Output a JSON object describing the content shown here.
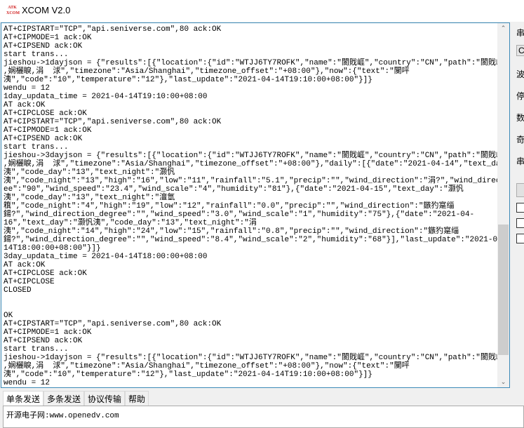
{
  "window": {
    "title": "XCOM V2.0",
    "logo_text": "ATK XCOM"
  },
  "receive_lines": [
    "AT+CIPSTART=\"TCP\",\"api.seniverse.com\",80 ack:OK",
    "AT+CIPMODE=1 ack:OK",
    "AT+CIPSEND ack:OK",
    "start trans...",
    "jieshou->1dayjson = {\"results\":[{\"location\":{\"id\":\"WTJJ6TY7ROFK\",\"name\":\"閬戝崕\",\"country\":\"CN\",\"path\":\"閬戝崕,閬戝崕",
    ",娴欐睙,涓  浗\",\"timezone\":\"Asia/Shanghai\",\"timezone_offset\":\"+08:00\"},\"now\":{\"text\":\"闃呯",
    "洟\",\"code\":\"10\",\"temperature\":\"12\"},\"last_update\":\"2021-04-14T19:10:00+08:00\"}]}",
    "wendu = 12",
    "1day_updata_time = 2021-04-14T19:10:00+08:00",
    "AT ack:OK",
    "AT+CIPCLOSE ack:OK",
    "AT+CIPSTART=\"TCP\",\"api.seniverse.com\",80 ack:OK",
    "AT+CIPMODE=1 ack:OK",
    "AT+CIPSEND ack:OK",
    "start trans...",
    "jieshou->3dayjson = {\"results\":[{\"location\":{\"id\":\"WTJJ6TY7ROFK\",\"name\":\"閬戝崕\",\"country\":\"CN\",\"path\":\"閬戝崕,閬戝崕",
    ",娴欐睙,涓  浗\",\"timezone\":\"Asia/Shanghai\",\"timezone_offset\":\"+08:00\"},\"daily\":[{\"date\":\"2021-04-14\",\"text_day\":\"灏忛",
    "洟\",\"code_day\":\"13\",\"text_night\":\"灏忛",
    "洟\",\"code_night\":\"13\",\"high\":\"16\",\"low\":\"11\",\"rainfall\":\"5.1\",\"precip\":\"\",\"wind_direction\":\"涓?\",\"wind_direction_degr",
    "ee\":\"90\",\"wind_speed\":\"23.4\",\"wind_scale\":\"4\",\"humidity\":\"81\"},{\"date\":\"2021-04-15\",\"text_day\":\"灏忛",
    "洟\",\"code_day\":\"13\",\"text_night\":\"澶氫",
    "簯\",\"code_night\":\"4\",\"high\":\"19\",\"low\":\"12\",\"rainfall\":\"0.0\",\"precip\":\"\",\"wind_direction\":\"鏃犳寔缁",
    "鍚?\",\"wind_direction_degree\":\"\",\"wind_speed\":\"3.0\",\"wind_scale\":\"1\",\"humidity\":\"75\"},{\"date\":\"2021-04-",
    "16\",\"text_day\":\"灏忛洟\",\"code_day\":\"13\",\"text_night\":\"涓",
    "洟\",\"code_night\":\"14\",\"high\":\"24\",\"low\":\"15\",\"rainfall\":\"0.8\",\"precip\":\"\",\"wind_direction\":\"鏃犳寔缁",
    "鍚?\",\"wind_direction_degree\":\"\",\"wind_speed\":\"8.4\",\"wind_scale\":\"2\",\"humidity\":\"68\"}],\"last_update\":\"2021-04-",
    "14T18:00:00+08:00\"}]}",
    "3day_updata_time = 2021-04-14T18:00:00+08:00",
    "AT ack:OK",
    "AT+CIPCLOSE ack:OK",
    "AT+CIPCLOSE",
    "CLOSED",
    "",
    "",
    "OK",
    "AT+CIPSTART=\"TCP\",\"api.seniverse.com\",80 ack:OK",
    "AT+CIPMODE=1 ack:OK",
    "AT+CIPSEND ack:OK",
    "start trans...",
    "jieshou->1dayjson = {\"results\":[{\"location\":{\"id\":\"WTJJ6TY7ROFK\",\"name\":\"閬戝崕\",\"country\":\"CN\",\"path\":\"閬戝崕,閬戝崕",
    ",娴欐睙,涓  浗\",\"timezone\":\"Asia/Shanghai\",\"timezone_offset\":\"+08:00\"},\"now\":{\"text\":\"闃呯",
    "洟\",\"code\":\"10\",\"temperature\":\"12\"},\"last_update\":\"2021-04-14T19:10:00+08:00\"}]}",
    "wendu = 12",
    "1day_updata_time = 2021-04-14T19:10:00+08:00"
  ],
  "scrollbar": {
    "position_fraction": 0.55
  },
  "side_panel": {
    "labels": [
      "串",
      "C",
      "波",
      "停",
      "数",
      "奇",
      "串"
    ]
  },
  "tabs": [
    "单条发送",
    "多条发送",
    "协议传输",
    "帮助"
  ],
  "send_input": {
    "value": "开源电子网:www.openedv.com"
  }
}
